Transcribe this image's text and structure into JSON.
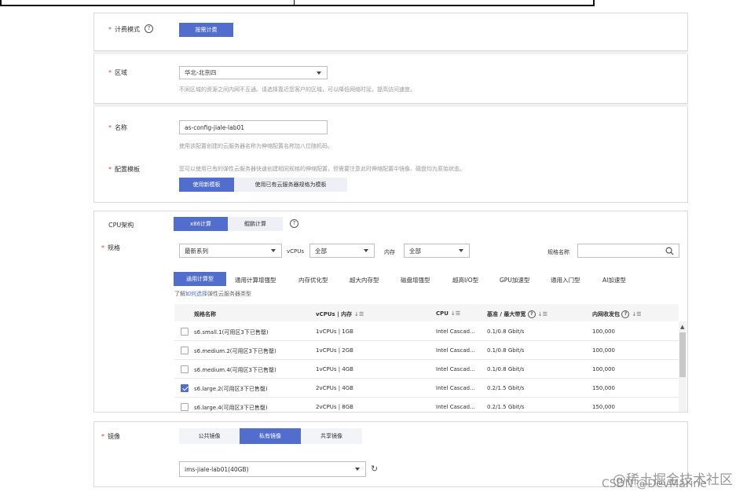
{
  "billing": {
    "label": "计费模式",
    "help": "?",
    "option": "按需计费"
  },
  "region": {
    "label": "区域",
    "value": "华北-北京四",
    "hint": "不同区域的资源之间内网不互通。请选择靠近您客户的区域，可以降低网络时延，提高访问速度。"
  },
  "name": {
    "label": "名称",
    "value": "as-config-jiale-lab01",
    "hint": "使用该配置创建的云服务器名称为伸缩配置名称加八位随机码。"
  },
  "template": {
    "label": "配置模板",
    "hint": "您可以使用已有的弹性云服务器快速创建相同规格的伸缩配置，但需要注意此时伸缩配置中镜像、磁盘均为原始状态。",
    "new_button": "使用新模板",
    "existing_button": "使用已有云服务器规格为模板"
  },
  "cpu": {
    "label": "CPU架构",
    "tabs": [
      "x86计算",
      "鲲鹏计算"
    ],
    "active": 0,
    "help": "?"
  },
  "spec": {
    "label": "规格",
    "series_value": "最新系列",
    "vcpus_label": "vCPUs",
    "vcpus_value": "全部",
    "memory_label": "内存",
    "memory_value": "全部",
    "spec_name_label": "规格名称",
    "search_placeholder": "",
    "types": [
      "通用计算型",
      "通用计算增强型",
      "内存优化型",
      "超大内存型",
      "磁盘增强型",
      "超高I/O型",
      "GPU加速型",
      "通用入门型",
      "AI加速型"
    ],
    "active_type": 0,
    "learn_prefix": "了解",
    "learn_link": "如何选择",
    "learn_suffix": "弹性云服务器类型",
    "columns": [
      "规格名称",
      "vCPUs | 内存",
      "CPU",
      "基准 / 最大带宽",
      "内网收发包"
    ],
    "rows": [
      {
        "name": "s6.small.1(可用区3下已售罄)",
        "vcpu_mem": "1vCPUs | 1GB",
        "cpu": "Intel Cascad...",
        "bandwidth": "0.1/0.8 Gbit/s",
        "pps": "100,000",
        "checked": false
      },
      {
        "name": "s6.medium.2(可用区3下已售罄)",
        "vcpu_mem": "1vCPUs | 2GB",
        "cpu": "Intel Cascad...",
        "bandwidth": "0.1/0.8 Gbit/s",
        "pps": "100,000",
        "checked": false
      },
      {
        "name": "s6.medium.4(可用区3下已售罄)",
        "vcpu_mem": "1vCPUs | 4GB",
        "cpu": "Intel Cascad...",
        "bandwidth": "0.1/0.8 Gbit/s",
        "pps": "100,000",
        "checked": false
      },
      {
        "name": "s6.large.2(可用区3下已售罄)",
        "vcpu_mem": "2vCPUs | 4GB",
        "cpu": "Intel Cascad...",
        "bandwidth": "0.2/1.5 Gbit/s",
        "pps": "150,000",
        "checked": true
      },
      {
        "name": "s6.large.4(可用区3下已售罄)",
        "vcpu_mem": "2vCPUs | 8GB",
        "cpu": "Intel Cascad...",
        "bandwidth": "0.2/1.5 Gbit/s",
        "pps": "150,000",
        "checked": false
      }
    ]
  },
  "image": {
    "label": "镜像",
    "tabs": [
      "公共镜像",
      "私有镜像",
      "共享镜像"
    ],
    "active": 1,
    "value": "ims-jiale-lab01(40GB)"
  },
  "watermark": {
    "line1": "@稀土掘金技术社区",
    "line2": "CSDN @DevMarine"
  },
  "colors": {
    "primary": "#526ecc",
    "required": "#e0433c"
  }
}
